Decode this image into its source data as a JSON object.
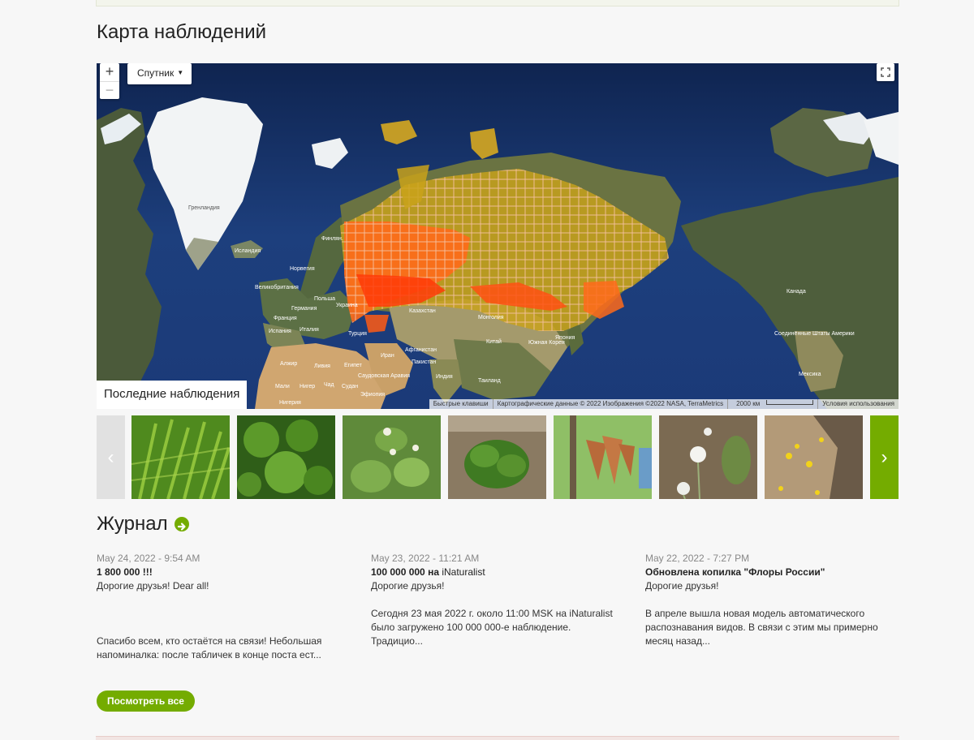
{
  "map_section": {
    "title": "Карта наблюдений",
    "zoom_in": "+",
    "zoom_out": "−",
    "map_type": "Спутник",
    "recent_tab": "Последние наблюдения",
    "attribution": {
      "shortcuts": "Быстрые клавиши",
      "data": "Картографические данные © 2022 Изображения ©2022 NASA, TerraMetrics",
      "scale": "2000 км",
      "terms": "Условия использования"
    },
    "labels": {
      "greenland": "Гренландия",
      "iceland": "Исландия",
      "norway": "Норвегия",
      "finland": "Финлян.",
      "uk": "Великобритания",
      "poland": "Польша",
      "germany": "Германия",
      "ukraine": "Украина",
      "france": "Франция",
      "italy": "Италия",
      "spain": "Испания",
      "kazakhstan": "Казахстан",
      "mongolia": "Монголия",
      "china": "Китай",
      "turkey": "Турция",
      "afghanistan": "Афганистан",
      "iran": "Иран",
      "pakistan": "Пакистан",
      "india": "Индия",
      "algeria": "Алжир",
      "libya": "Ливия",
      "egypt": "Египет",
      "saudi": "Саудовская Аравия",
      "mali": "Мали",
      "niger": "Нигер",
      "chad": "Чад",
      "sudan": "Судан",
      "ethiopia": "Эфиопия",
      "nigeria": "Нигерия",
      "south_korea": "Южная Корея",
      "japan": "Япония",
      "thailand": "Таиланд",
      "canada": "Канада",
      "usa": "Соединённые Штаты Америки",
      "mexico": "Мексика"
    }
  },
  "carousel": {
    "prev": "‹",
    "next": "›"
  },
  "journal": {
    "title": "Журнал",
    "posts": [
      {
        "date": "May 24, 2022 - 9:54 AM",
        "title": "1 800 000 !!!",
        "lead": "Дорогие друзья! Dear all!",
        "body": "Спасибо всем, кто остаётся на связи! Небольшая напоминалка: после табличек в конце поста ест..."
      },
      {
        "date": "May 23, 2022 - 11:21 AM",
        "title_a": "100 000 000",
        "title_b": " на ",
        "title_c": "iNaturalist",
        "lead": "Дорогие друзья!",
        "body": "Сегодня 23 мая 2022 г. около 11:00 MSK на iNaturalist было загружено 100 000 000-е наблюдение. Традицио..."
      },
      {
        "date": "May 22, 2022 - 7:27 PM",
        "title": "Обновлена копилка \"Флоры России\"",
        "lead": "Дорогие друзья!",
        "body": "В апреле вышла новая модель автоматического распознавания видов. В связи с этим мы примерно месяц назад..."
      }
    ],
    "view_all": "Посмотреть все"
  },
  "colors": {
    "accent": "#74ac00",
    "ocean": "#1a3466",
    "grid_fill": "#c9a21a",
    "hot": "#ff4a10"
  }
}
